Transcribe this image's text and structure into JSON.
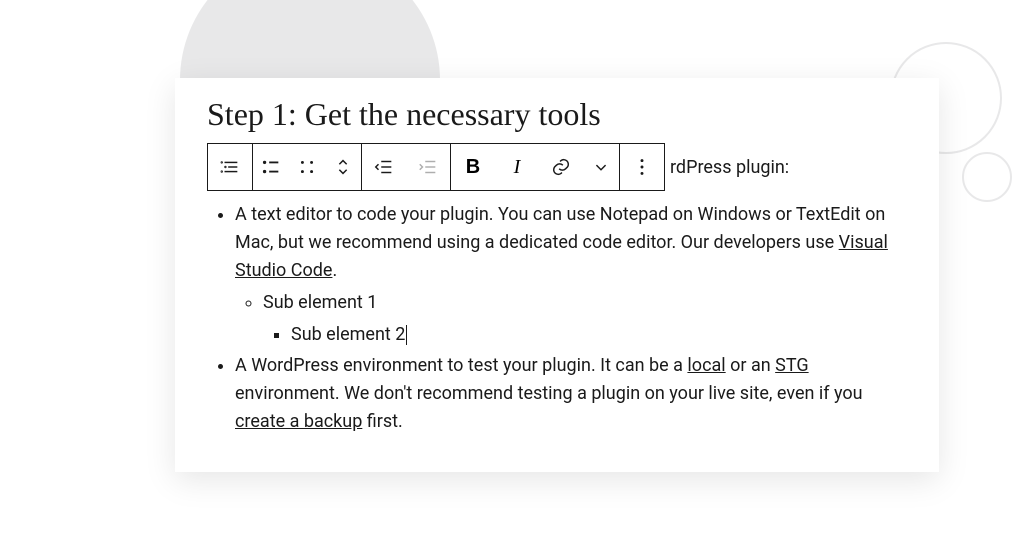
{
  "heading": "Step 1: Get the necessary tools",
  "trail_text": "rdPress plugin:",
  "icons": {
    "block_type": "list-block-icon",
    "bullet": "bullet-list-icon",
    "grid": "grid-icon",
    "updown": "updown-icon",
    "outdent": "outdent-icon",
    "indent": "indent-icon",
    "bold": "B",
    "italic": "I",
    "link": "link-icon",
    "caret": "chevron-down-icon",
    "more": "more-icon"
  },
  "list": {
    "item1": {
      "t1": "A text editor to code your plugin. You can use Notepad on Windows or TextEdit on Mac, but we recommend using a dedicated code editor. Our developers use ",
      "link1": "Visual Studio Code",
      "t2": "."
    },
    "sub1": "Sub element 1",
    "sub2": "Sub element 2",
    "item2": {
      "t1": "A WordPress environment to test your plugin. It can be a ",
      "link1": "local",
      "t2": " or an ",
      "link2": "STG",
      "t3": " environment. We don't recommend testing a plugin on your live site, even if you ",
      "link3": "create a backup",
      "t4": " first."
    }
  }
}
